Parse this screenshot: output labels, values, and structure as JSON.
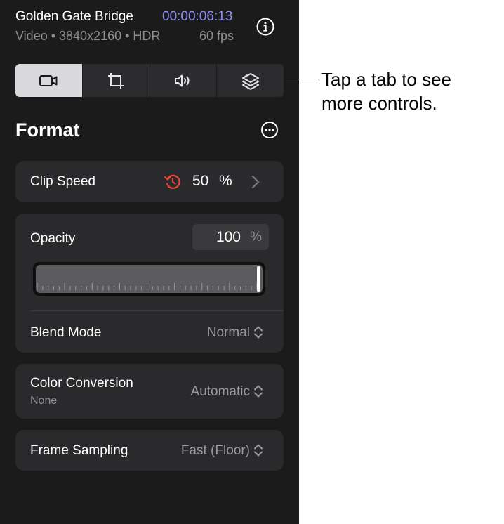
{
  "clip": {
    "title": "Golden Gate Bridge",
    "timecode": "00:00:06:13",
    "info": "Video • 3840x2160 • HDR",
    "fps": "60 fps"
  },
  "tabs": [
    {
      "icon": "video-camera-icon",
      "active": true
    },
    {
      "icon": "transform-icon",
      "active": false
    },
    {
      "icon": "speaker-icon",
      "active": false
    },
    {
      "icon": "layers-icon",
      "active": false
    }
  ],
  "section": {
    "title": "Format"
  },
  "clip_speed": {
    "label": "Clip Speed",
    "value": "50",
    "unit": "%"
  },
  "opacity": {
    "label": "Opacity",
    "value": "100",
    "unit": "%",
    "level": 1.0
  },
  "blend_mode": {
    "label": "Blend Mode",
    "value": "Normal"
  },
  "color_conversion": {
    "label": "Color Conversion",
    "sublabel": "None",
    "value": "Automatic"
  },
  "frame_sampling": {
    "label": "Frame Sampling",
    "value": "Fast (Floor)"
  },
  "callout": {
    "line1": "Tap a tab to see",
    "line2": "more controls."
  },
  "colors": {
    "accent": "#8f8cf7",
    "speed_icon": "#e5483b",
    "panel": "#1b1b1c",
    "card": "#2a2a2c"
  }
}
